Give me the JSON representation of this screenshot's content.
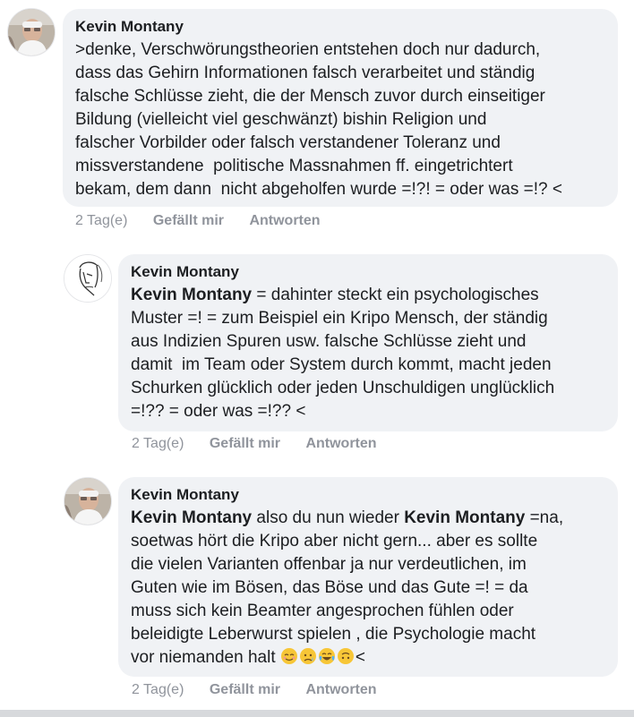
{
  "comments": [
    {
      "author": "Kevin Montany",
      "text": ">denke, Verschwörungstheorien entstehen doch nur dadurch,\ndass das Gehirn Informationen falsch verarbeitet und ständig\nfalsche Schlüsse zieht, die der Mensch zuvor durch einseitiger\nBildung (vielleicht viel geschwänzt) bishin Religion und\nfalscher Vorbilder oder falsch verstandener Toleranz und\nmissverstandene  politische Massnahmen ff. eingetrichtert\nbekam, dem dann  nicht abgeholfen wurde =!?! = oder was =!? <",
      "time": "2 Tag(e)",
      "like": "Gefällt mir",
      "reply": "Antworten",
      "avatar": "photo-avatar-icon"
    },
    {
      "author": "Kevin Montany",
      "mention1": "Kevin Montany",
      "text": " = dahinter steckt ein psychologisches\nMuster =! = zum Beispiel ein Kripo Mensch, der ständig\naus Indizien Spuren usw. falsche Schlüsse zieht und\ndamit  im Team oder System durch kommt, macht jeden\nSchurken glücklich oder jeden Unschuldigen unglücklich\n=!?? = oder was =!?? <",
      "time": "2 Tag(e)",
      "like": "Gefällt mir",
      "reply": "Antworten",
      "avatar": "sketch-face-avatar-icon"
    },
    {
      "author": "Kevin Montany",
      "mention1": "Kevin Montany",
      "text_mid": " also du nun wieder ",
      "mention2": "Kevin Montany",
      "text": " =na,\nsoetwas hört die Kripo aber nicht gern... aber es sollte\ndie vielen Varianten offenbar ja nur verdeutlichen, im\nGuten wie im Bösen, das Böse und das Gute =! = da\nmuss sich kein Beamter angesprochen fühlen oder\nbeleidigte Leberwurst spielen , die Psychologie macht\nvor niemanden halt ",
      "text_end": "<",
      "emojis": [
        "relieved-face-emoji",
        "worried-face-emoji",
        "tears-of-joy-emoji",
        "upside-down-face-emoji"
      ],
      "time": "2 Tag(e)",
      "like": "Gefällt mir",
      "reply": "Antworten",
      "avatar": "photo-avatar-icon"
    }
  ],
  "colors": {
    "bubble": "#f0f2f5",
    "meta": "#90949c",
    "text": "#1c1e21",
    "emoji_yellow": "#f7c637"
  }
}
